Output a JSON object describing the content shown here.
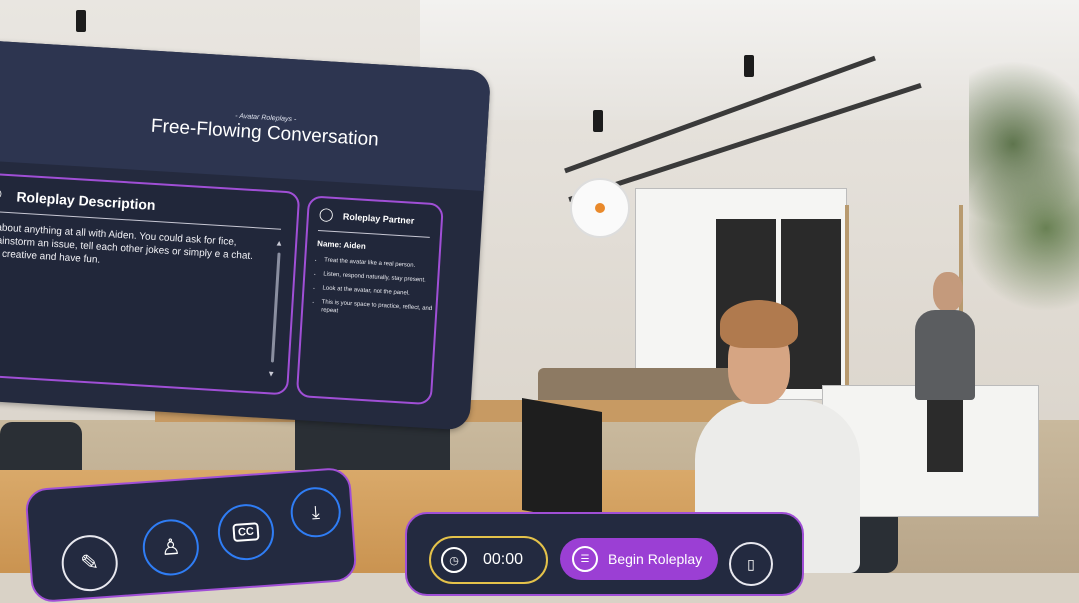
{
  "panel": {
    "subtitle": "- Avatar Roleplays -",
    "title": "Free-Flowing Conversation"
  },
  "description": {
    "icon": "user-icon",
    "title": "Roleplay Description",
    "text": "k about anything at all with Aiden. You could ask for fice, brainstorm an issue, tell each other jokes or simply e a chat. Be creative and have fun."
  },
  "partner": {
    "icon": "person-icon",
    "title": "Roleplay Partner",
    "name": "Name: Aiden",
    "tips": [
      "Treat the avatar like a real person.",
      "Listen, respond naturally, stay present.",
      "Look at the avatar, not the panel.",
      "This is your space to practice, reflect, and repeat"
    ]
  },
  "toolbar": {
    "cc_label": "CC",
    "timer": "00:00",
    "begin_label": "Begin Roleplay"
  },
  "accent": "#a04fd6"
}
